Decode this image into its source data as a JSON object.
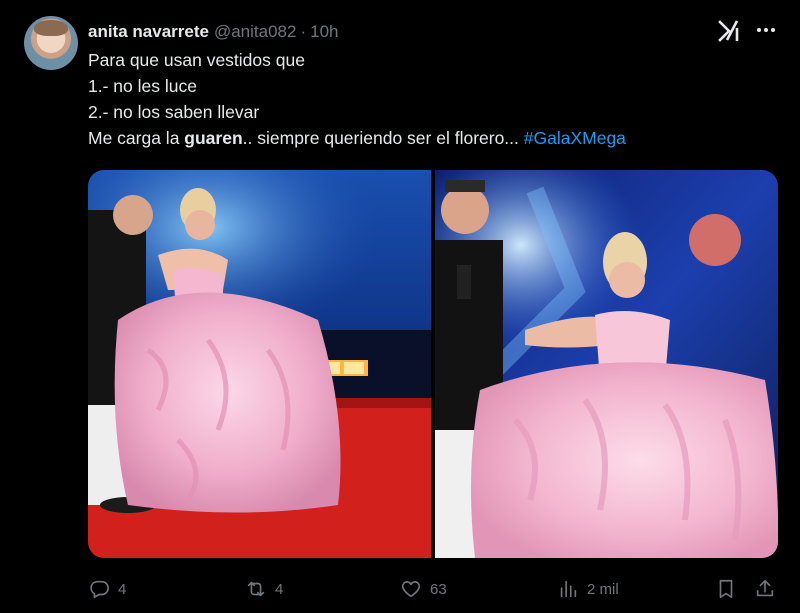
{
  "author": {
    "name": "anita navarrete",
    "handle": "@anita082",
    "separator": "·",
    "time": "10h"
  },
  "tweet": {
    "line1": "Para que usan vestidos que",
    "line2": "1.- no les luce",
    "line3": "2.- no los saben llevar",
    "line4_prefix": "Me carga la ",
    "line4_bold": "guaren",
    "line4_suffix": ".. siempre queriendo ser el florero... ",
    "hashtag": "#GalaXMega"
  },
  "media": {
    "images": [
      {
        "name": "photo-1"
      },
      {
        "name": "photo-2"
      }
    ]
  },
  "actions": {
    "reply_count": "4",
    "retweet_count": "4",
    "like_count": "63",
    "views_count": "2 mil"
  },
  "icons": {
    "grok": "grok-icon",
    "more": "more-icon",
    "reply": "reply-icon",
    "retweet": "retweet-icon",
    "like": "heart-icon",
    "views": "views-icon",
    "bookmark": "bookmark-icon",
    "share": "share-icon"
  },
  "colors": {
    "background": "#000000",
    "text": "#e7e9ea",
    "muted": "#71767b",
    "link": "#1d9bf0"
  }
}
